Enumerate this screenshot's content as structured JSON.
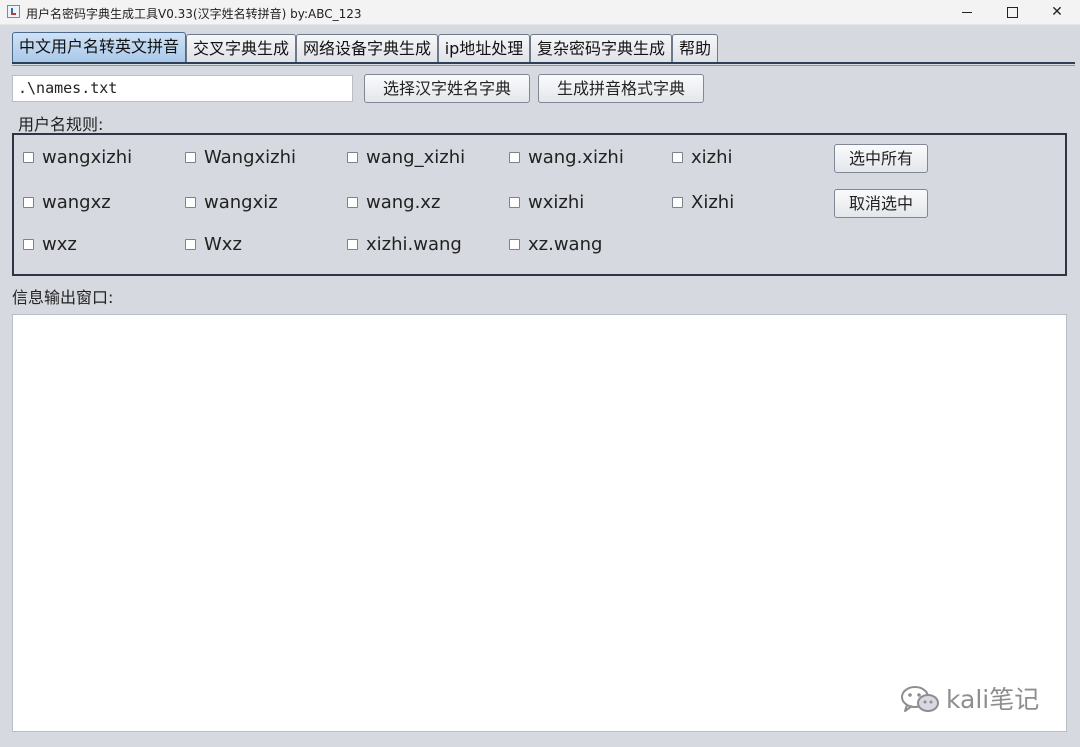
{
  "window": {
    "title": "用户名密码字典生成工具V0.33(汉字姓名转拼音) by:ABC_123",
    "close_glyph": "✕"
  },
  "tabs": [
    {
      "label": "中文用户名转英文拼音",
      "active": true
    },
    {
      "label": "交叉字典生成"
    },
    {
      "label": "网络设备字典生成"
    },
    {
      "label": "ip地址处理"
    },
    {
      "label": "复杂密码字典生成"
    },
    {
      "label": "帮助"
    }
  ],
  "toolbar": {
    "file_path": ".\\names.txt",
    "select_dict_label": "选择汉字姓名字典",
    "generate_label": "生成拼音格式字典"
  },
  "rules": {
    "heading": "用户名规则:",
    "options": [
      "wangxizhi",
      "Wangxizhi",
      "wang_xizhi",
      "wang.xizhi",
      "xizhi",
      "wangxz",
      "wangxiz",
      "wang.xz",
      "wxizhi",
      "Xizhi",
      "wxz",
      "Wxz",
      "xizhi.wang",
      "xz.wang"
    ],
    "select_all_label": "选中所有",
    "deselect_label": "取消选中"
  },
  "output": {
    "heading": "信息输出窗口:",
    "content": ""
  },
  "watermark": {
    "text": "kali笔记",
    "icon": "wechat-icon"
  }
}
